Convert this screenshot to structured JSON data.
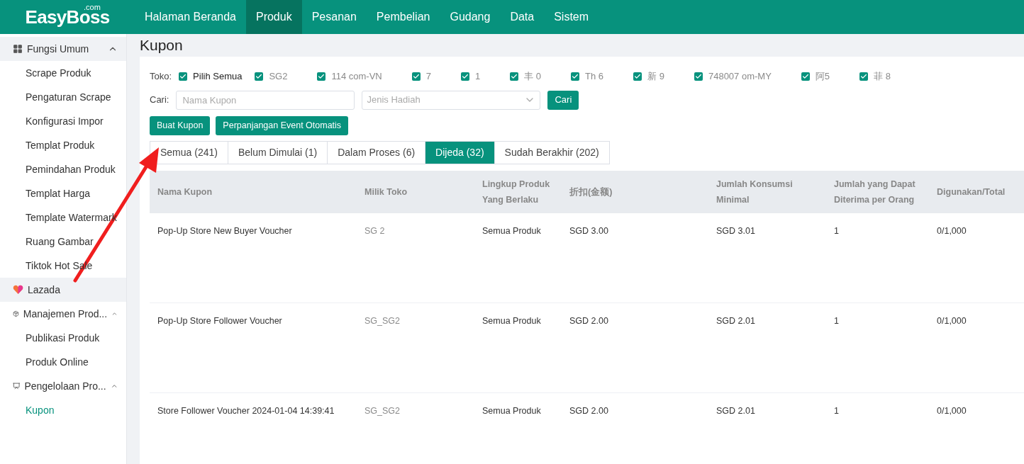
{
  "header": {
    "logo": "EasyBoss",
    "logo_suffix": ".com",
    "nav": [
      {
        "label": "Halaman Beranda",
        "selected": false
      },
      {
        "label": "Produk",
        "selected": true
      },
      {
        "label": "Pesanan",
        "selected": false
      },
      {
        "label": "Pembelian",
        "selected": false
      },
      {
        "label": "Gudang",
        "selected": false
      },
      {
        "label": "Data",
        "selected": false
      },
      {
        "label": "Sistem",
        "selected": false
      }
    ]
  },
  "sidebar": {
    "items": [
      {
        "label": "Fungsi Umum",
        "kind": "group",
        "expanded": true,
        "selected": true,
        "children": [
          {
            "label": "Scrape Produk",
            "selected": false
          },
          {
            "label": "Pengaturan Scrape",
            "selected": false
          },
          {
            "label": "Konfigurasi Impor",
            "selected": false
          },
          {
            "label": "Templat Produk",
            "selected": false
          },
          {
            "label": "Pemindahan Produk",
            "selected": false
          },
          {
            "label": "Templat Harga",
            "selected": false
          },
          {
            "label": "Template Watermark",
            "selected": false
          },
          {
            "label": "Ruang Gambar",
            "selected": false
          },
          {
            "label": "Tiktok Hot Sale",
            "selected": false
          }
        ]
      },
      {
        "label": "Lazada",
        "kind": "platform",
        "selected": true
      },
      {
        "label": "Manajemen Prod...",
        "kind": "group",
        "expanded": true,
        "selected": false,
        "children": [
          {
            "label": "Publikasi Produk",
            "selected": false
          },
          {
            "label": "Produk Online",
            "selected": false
          }
        ]
      },
      {
        "label": "Pengelolaan Pro...",
        "kind": "group",
        "expanded": true,
        "selected": false,
        "children": [
          {
            "label": "Kupon",
            "selected": true
          }
        ]
      }
    ]
  },
  "page_title": "Kupon",
  "filters": {
    "shop_label": "Toko:",
    "shops": [
      {
        "label": "Pilih Semua",
        "checked": true
      },
      {
        "label": "SG2",
        "checked": true
      },
      {
        "label": "114 com-VN",
        "checked": true
      },
      {
        "label": "7",
        "checked": true
      },
      {
        "label": "1",
        "checked": true
      },
      {
        "label": "丰 0",
        "checked": true
      },
      {
        "label": "Th 6",
        "checked": true
      },
      {
        "label": "新 9",
        "checked": true
      },
      {
        "label": "748007 om-MY",
        "checked": true
      },
      {
        "label": "阿5",
        "checked": true
      },
      {
        "label": "菲 8",
        "checked": true
      }
    ],
    "search_label": "Cari:",
    "name_field": {
      "placeholder": "Nama Kupon"
    },
    "type_select": {
      "placeholder": "Jenis Hadiah"
    },
    "search_button": "Cari"
  },
  "actions": [
    "Buat Kupon",
    "Perpanjangan Event Otomatis"
  ],
  "tabs": [
    {
      "label": "Semua (241)",
      "selected": false
    },
    {
      "label": "Belum Dimulai (1)",
      "selected": false
    },
    {
      "label": "Dalam Proses (6)",
      "selected": false
    },
    {
      "label": "Dijeda (32)",
      "selected": true
    },
    {
      "label": "Sudah Berakhir (202)",
      "selected": false
    }
  ],
  "table": {
    "columns": [
      "Nama Kupon",
      "Milik Toko",
      "Lingkup Produk Yang Berlaku",
      "折扣(金额)",
      "Jumlah Konsumsi Minimal",
      "Jumlah yang Dapat Diterima per Orang",
      "Digunakan/Total"
    ],
    "rows": [
      [
        "Pop-Up Store New Buyer Voucher",
        "SG 2",
        "Semua Produk",
        "SGD 3.00",
        "SGD 3.01",
        "1",
        "0/1,000"
      ],
      [
        "Pop-Up Store Follower Voucher",
        "SG_SG2",
        "Semua Produk",
        "SGD 2.00",
        "SGD 2.01",
        "1",
        "0/1,000"
      ],
      [
        "Store Follower Voucher 2024-01-04 14:39:41",
        "SG_SG2",
        "Semua Produk",
        "SGD 2.00",
        "SGD 2.01",
        "1",
        "0/1,000"
      ]
    ]
  }
}
